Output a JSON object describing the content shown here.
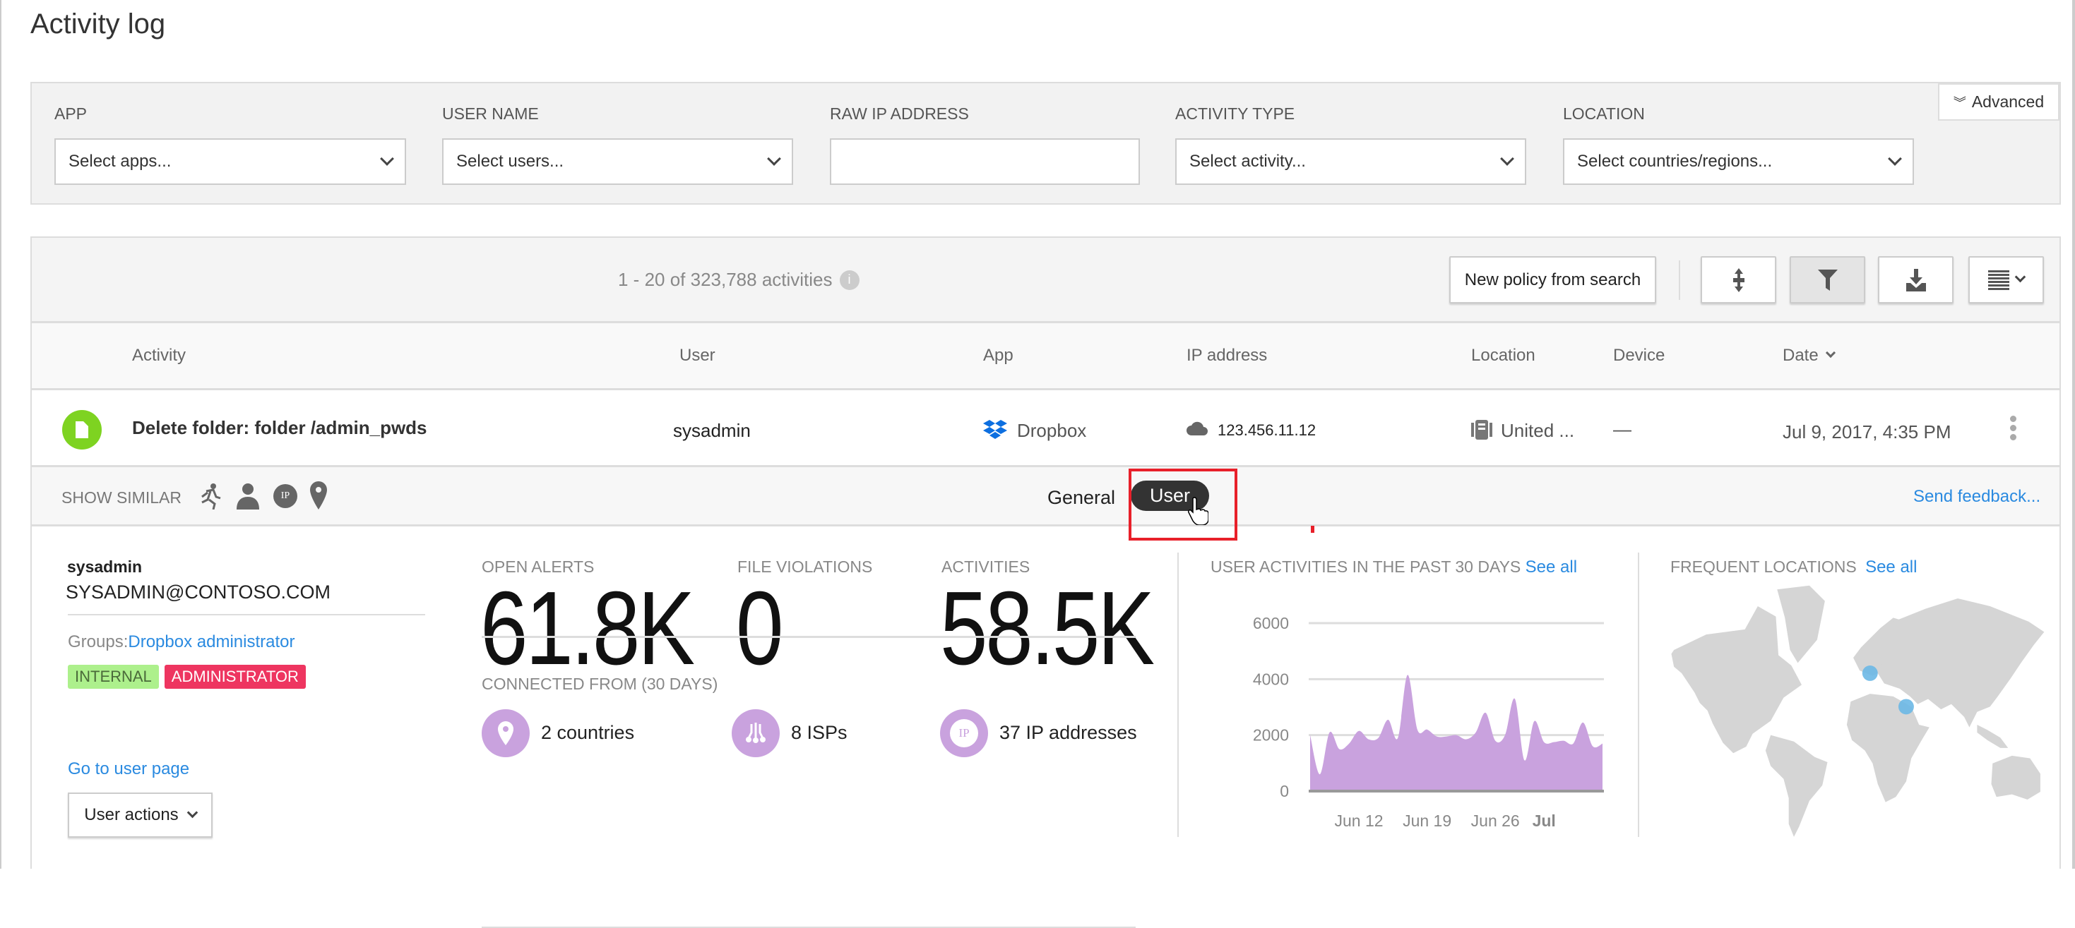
{
  "page_title": "Activity log",
  "filters": {
    "advanced_label": "Advanced",
    "fields": [
      {
        "label": "APP",
        "value": "Select apps..."
      },
      {
        "label": "USER NAME",
        "value": "Select users..."
      },
      {
        "label": "RAW IP ADDRESS",
        "value": ""
      },
      {
        "label": "ACTIVITY TYPE",
        "value": "Select activity..."
      },
      {
        "label": "LOCATION",
        "value": "Select countries/regions..."
      }
    ]
  },
  "toolbar": {
    "count_text": "1 - 20 of 323,788 activities",
    "new_policy_label": "New policy from search"
  },
  "table": {
    "columns": [
      "Activity",
      "User",
      "App",
      "IP address",
      "Location",
      "Device",
      "Date"
    ],
    "rows": [
      {
        "activity": "Delete folder: folder /admin_pwds",
        "user": "sysadmin",
        "app": "Dropbox",
        "ip": "123.456.11.12",
        "location": "United ...",
        "device": "—",
        "date": "Jul 9, 2017, 4:35 PM"
      }
    ]
  },
  "similar": {
    "label": "SHOW SIMILAR",
    "tabs": [
      "General",
      "User"
    ],
    "active_tab": "User",
    "feedback": "Send feedback..."
  },
  "user": {
    "name": "sysadmin",
    "email": "SYSADMIN@CONTOSO.COM",
    "groups_label": "Groups:",
    "groups_value": "Dropbox administrator",
    "badges": [
      {
        "text": "INTERNAL",
        "bg": "#adf08c",
        "fg": "#4a6a3a"
      },
      {
        "text": "ADMINISTRATOR",
        "bg": "#ee3560",
        "fg": "#ffffff"
      }
    ],
    "go_to_user": "Go to user page",
    "user_actions": "User actions"
  },
  "stats": {
    "open_alerts_label": "OPEN ALERTS",
    "open_alerts": "61.8K",
    "file_violations_label": "FILE VIOLATIONS",
    "file_violations": "0",
    "activities_label": "ACTIVITIES",
    "activities": "58.5K",
    "connected_label": "CONNECTED FROM (30 DAYS)",
    "countries": "2 countries",
    "isps": "8 ISPs",
    "ips": "37 IP addresses"
  },
  "activity_panel": {
    "title": "USER ACTIVITIES IN THE PAST 30 DAYS",
    "see_all": "See all"
  },
  "locations_panel": {
    "title": "FREQUENT LOCATIONS",
    "see_all": "See all"
  },
  "colors": {
    "accent": "#2a8ae0",
    "area": "#c9a2de",
    "status_green": "#7ed321",
    "highlight": "#e8202a"
  },
  "chart_data": {
    "type": "area",
    "title": "USER ACTIVITIES IN THE PAST 30 DAYS",
    "x": [
      "Jun 7",
      "Jun 8",
      "Jun 9",
      "Jun 10",
      "Jun 11",
      "Jun 12",
      "Jun 13",
      "Jun 14",
      "Jun 15",
      "Jun 16",
      "Jun 17",
      "Jun 18",
      "Jun 19",
      "Jun 20",
      "Jun 21",
      "Jun 22",
      "Jun 23",
      "Jun 24",
      "Jun 25",
      "Jun 26",
      "Jun 27",
      "Jun 28",
      "Jun 29",
      "Jun 30",
      "Jul 1",
      "Jul 2",
      "Jul 3",
      "Jul 4",
      "Jul 5",
      "Jul 6",
      "Jul 7"
    ],
    "values": [
      2000,
      600,
      2100,
      1500,
      1700,
      2150,
      1850,
      1900,
      2550,
      1900,
      4150,
      2200,
      2200,
      1950,
      1950,
      2000,
      1850,
      2100,
      2800,
      1800,
      2000,
      3300,
      1100,
      2500,
      1750,
      1750,
      1800,
      1700,
      2450,
      1600,
      1700
    ],
    "yticks": [
      "0",
      "2000",
      "4000",
      "6000"
    ],
    "ylim": [
      0,
      6000
    ],
    "xticks": [
      {
        "label": "Jun 12",
        "index": 5
      },
      {
        "label": "Jun 19",
        "index": 12
      },
      {
        "label": "Jun 26",
        "index": 19
      },
      {
        "label": "Jul",
        "index": 24
      }
    ],
    "grid": true
  }
}
